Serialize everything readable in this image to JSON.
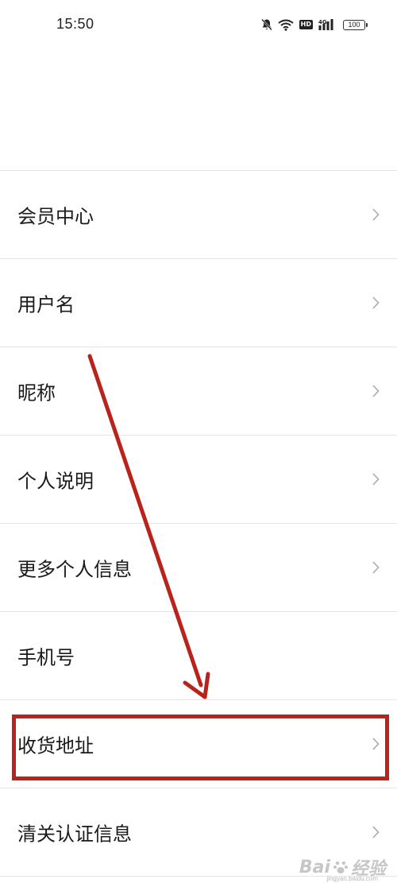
{
  "status_bar": {
    "time": "15:50",
    "battery_level": "100",
    "network_badge": "HD",
    "signal_label": "4G",
    "icons": [
      "bell-muted-icon",
      "wifi-icon",
      "hd-icon",
      "signal-icon",
      "battery-icon"
    ]
  },
  "menu": {
    "items": [
      {
        "label": "会员中心",
        "chevron": true
      },
      {
        "label": "用户名",
        "chevron": true
      },
      {
        "label": "昵称",
        "chevron": true
      },
      {
        "label": "个人说明",
        "chevron": true
      },
      {
        "label": "更多个人信息",
        "chevron": true
      },
      {
        "label": "手机号",
        "chevron": false
      },
      {
        "label": "收货地址",
        "chevron": true
      },
      {
        "label": "清关认证信息",
        "chevron": true
      }
    ]
  },
  "annotation": {
    "color": "#b8241b",
    "highlighted_item": "收货地址"
  },
  "watermark": {
    "brand": "Bai",
    "brand_suffix": "经验",
    "url": "jingyan.baidu.com"
  }
}
